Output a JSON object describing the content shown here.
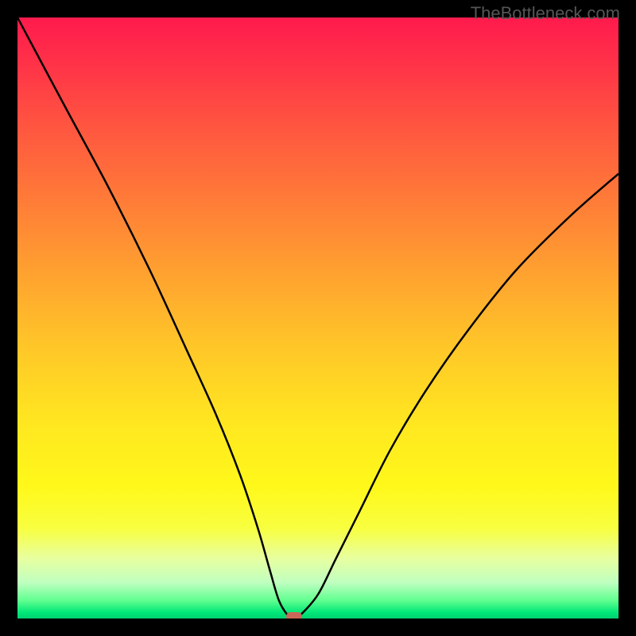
{
  "watermark": "TheBottleneck.com",
  "chart_data": {
    "type": "line",
    "title": "",
    "xlabel": "",
    "ylabel": "",
    "xlim": [
      0,
      100
    ],
    "ylim": [
      0,
      100
    ],
    "series": [
      {
        "name": "bottleneck-curve",
        "x": [
          0,
          8,
          15,
          22,
          28,
          33,
          37,
          40,
          42,
          43.5,
          45,
          46,
          47,
          50,
          53,
          57,
          62,
          68,
          75,
          83,
          92,
          100
        ],
        "values": [
          100,
          85,
          72,
          58,
          45,
          34,
          24,
          15,
          8,
          3,
          0.5,
          0,
          0.5,
          4,
          10,
          18,
          28,
          38,
          48,
          58,
          67,
          74
        ]
      }
    ],
    "marker": {
      "x": 46,
      "y": 0
    },
    "gradient_stops": [
      {
        "pos": 0,
        "color": "#ff1a4d"
      },
      {
        "pos": 50,
        "color": "#ffc020"
      },
      {
        "pos": 85,
        "color": "#ffff30"
      },
      {
        "pos": 100,
        "color": "#00d070"
      }
    ]
  }
}
